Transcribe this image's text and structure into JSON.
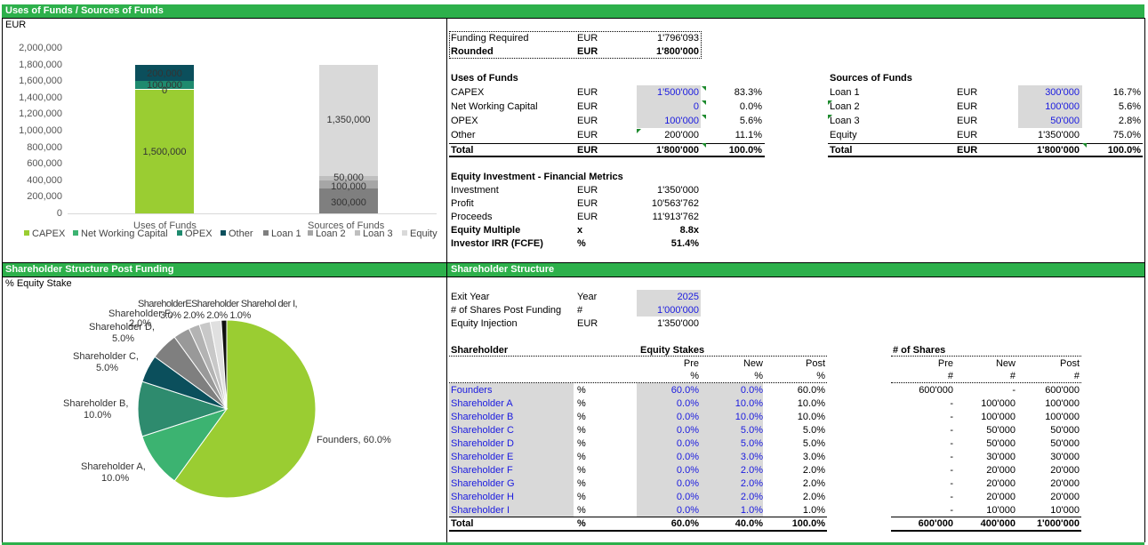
{
  "sections": {
    "uses_sources": "Uses of Funds / Sources of Funds",
    "shareholder_post": "Shareholder Structure Post Funding",
    "shareholder_structure": "Shareholder Structure"
  },
  "chart1": {
    "unit": "EUR",
    "y_ticks": [
      "2,000,000",
      "1,800,000",
      "1,600,000",
      "1,400,000",
      "1,200,000",
      "1,000,000",
      "800,000",
      "600,000",
      "400,000",
      "200,000",
      "0"
    ],
    "categories": [
      "Uses of Funds",
      "Sources of Funds"
    ],
    "labels": {
      "capex": "1,500,000",
      "opex": "100,000",
      "nwc": "0",
      "other": "200,000",
      "equity": "1,350,000",
      "loan3": "50,000",
      "loan2": "100,000",
      "loan1": "300,000"
    },
    "legend": [
      "CAPEX",
      "Net Working Capital",
      "OPEX",
      "Other",
      "Loan 1",
      "Loan 2",
      "Loan 3",
      "Equity"
    ],
    "colors": {
      "capex": "#9acd32",
      "nwc": "#3cb371",
      "opex": "#1e8a6e",
      "other": "#0b4f5c",
      "loan1": "#7f7f7f",
      "loan2": "#a6a6a6",
      "loan3": "#bfbfbf",
      "equity": "#d9d9d9"
    }
  },
  "chart_data": [
    {
      "type": "bar",
      "title": "",
      "ylabel": "EUR",
      "ylim": [
        0,
        2000000
      ],
      "categories": [
        "Uses of Funds",
        "Sources of Funds"
      ],
      "series": [
        {
          "name": "CAPEX",
          "values": [
            1500000,
            0
          ]
        },
        {
          "name": "Net Working Capital",
          "values": [
            0,
            0
          ]
        },
        {
          "name": "OPEX",
          "values": [
            100000,
            0
          ]
        },
        {
          "name": "Other",
          "values": [
            200000,
            0
          ]
        },
        {
          "name": "Loan 1",
          "values": [
            0,
            300000
          ]
        },
        {
          "name": "Loan 2",
          "values": [
            0,
            100000
          ]
        },
        {
          "name": "Loan 3",
          "values": [
            0,
            50000
          ]
        },
        {
          "name": "Equity",
          "values": [
            0,
            1350000
          ]
        }
      ]
    },
    {
      "type": "pie",
      "title": "% Equity Stake",
      "categories": [
        "Founders",
        "Shareholder A",
        "Shareholder B",
        "Shareholder C",
        "Shareholder D",
        "Shareholder E",
        "Shareholder F",
        "Shareholder G",
        "Shareholder H",
        "Shareholder I"
      ],
      "values": [
        60.0,
        10.0,
        10.0,
        5.0,
        5.0,
        3.0,
        2.0,
        2.0,
        2.0,
        1.0
      ]
    }
  ],
  "pie": {
    "title": "% Equity Stake",
    "labels": {
      "founders": "Founders, 60.0%",
      "a1": "Shareholder A,",
      "a2": "10.0%",
      "b1": "Shareholder B,",
      "b2": "10.0%",
      "c1": "Shareholder C,",
      "c2": "5.0%",
      "d1": "Shareholder D,",
      "d2": "5.0%",
      "e_cluster": "ShareholderEShareholder Sharehol der I,",
      "e_vals": "3.0%  2.0%  2.0%  1.0%",
      "e_cluster2": "Shareholder F,",
      "e_cluster3": "2.0%"
    },
    "colors": [
      "#9acd32",
      "#3cb371",
      "#2e8b6e",
      "#0b4f5c",
      "#7f7f7f",
      "#999999",
      "#b3b3b3",
      "#c8c8c8",
      "#e0e0e0",
      "#111111"
    ]
  },
  "funding": {
    "required_label": "Funding Required",
    "required_cur": "EUR",
    "required_val": "1'796'093",
    "rounded_label": "Rounded",
    "rounded_cur": "EUR",
    "rounded_val": "1'800'000"
  },
  "uses": {
    "title": "Uses of Funds",
    "rows": [
      {
        "label": "CAPEX",
        "cur": "EUR",
        "val": "1'500'000",
        "pct": "83.3%"
      },
      {
        "label": "Net Working Capital",
        "cur": "EUR",
        "val": "0",
        "pct": "0.0%"
      },
      {
        "label": "OPEX",
        "cur": "EUR",
        "val": "100'000",
        "pct": "5.6%"
      },
      {
        "label": "Other",
        "cur": "EUR",
        "val": "200'000",
        "pct": "11.1%"
      }
    ],
    "total": {
      "label": "Total",
      "cur": "EUR",
      "val": "1'800'000",
      "pct": "100.0%"
    }
  },
  "sources": {
    "title": "Sources of Funds",
    "rows": [
      {
        "label": "Loan 1",
        "cur": "EUR",
        "val": "300'000",
        "pct": "16.7%"
      },
      {
        "label": "Loan 2",
        "cur": "EUR",
        "val": "100'000",
        "pct": "5.6%"
      },
      {
        "label": "Loan 3",
        "cur": "EUR",
        "val": "50'000",
        "pct": "2.8%"
      },
      {
        "label": "Equity",
        "cur": "EUR",
        "val": "1'350'000",
        "pct": "75.0%"
      }
    ],
    "total": {
      "label": "Total",
      "cur": "EUR",
      "val": "1'800'000",
      "pct": "100.0%"
    }
  },
  "metrics": {
    "title": "Equity Investment - Financial Metrics",
    "rows": [
      {
        "label": "Investment",
        "cur": "EUR",
        "val": "1'350'000",
        "bold": false
      },
      {
        "label": "Profit",
        "cur": "EUR",
        "val": "10'563'762",
        "bold": false
      },
      {
        "label": "Proceeds",
        "cur": "EUR",
        "val": "11'913'762",
        "bold": false
      },
      {
        "label": "Equity Multiple",
        "cur": "x",
        "val": "8.8x",
        "bold": true
      },
      {
        "label": "Investor IRR (FCFE)",
        "cur": "%",
        "val": "51.4%",
        "bold": true
      }
    ]
  },
  "structure": {
    "exit_label": "Exit Year",
    "exit_unit": "Year",
    "exit_val": "2025",
    "shares_label": "# of Shares Post Funding",
    "shares_unit": "#",
    "shares_val": "1'000'000",
    "inj_label": "Equity Injection",
    "inj_unit": "EUR",
    "inj_val": "1'350'000",
    "col_shareholder": "Shareholder",
    "col_stakes": "Equity Stakes",
    "col_shares": "# of Shares",
    "pre": "Pre",
    "new": "New",
    "post": "Post",
    "pct": "%",
    "hash": "#",
    "rows": [
      {
        "name": "Founders",
        "u": "%",
        "pre": "60.0%",
        "new": "0.0%",
        "post": "60.0%",
        "spre": "600'000",
        "snew": "-",
        "spost": "600'000"
      },
      {
        "name": "Shareholder A",
        "u": "%",
        "pre": "0.0%",
        "new": "10.0%",
        "post": "10.0%",
        "spre": "-",
        "snew": "100'000",
        "spost": "100'000"
      },
      {
        "name": "Shareholder B",
        "u": "%",
        "pre": "0.0%",
        "new": "10.0%",
        "post": "10.0%",
        "spre": "-",
        "snew": "100'000",
        "spost": "100'000"
      },
      {
        "name": "Shareholder C",
        "u": "%",
        "pre": "0.0%",
        "new": "5.0%",
        "post": "5.0%",
        "spre": "-",
        "snew": "50'000",
        "spost": "50'000"
      },
      {
        "name": "Shareholder D",
        "u": "%",
        "pre": "0.0%",
        "new": "5.0%",
        "post": "5.0%",
        "spre": "-",
        "snew": "50'000",
        "spost": "50'000"
      },
      {
        "name": "Shareholder E",
        "u": "%",
        "pre": "0.0%",
        "new": "3.0%",
        "post": "3.0%",
        "spre": "-",
        "snew": "30'000",
        "spost": "30'000"
      },
      {
        "name": "Shareholder F",
        "u": "%",
        "pre": "0.0%",
        "new": "2.0%",
        "post": "2.0%",
        "spre": "-",
        "snew": "20'000",
        "spost": "20'000"
      },
      {
        "name": "Shareholder G",
        "u": "%",
        "pre": "0.0%",
        "new": "2.0%",
        "post": "2.0%",
        "spre": "-",
        "snew": "20'000",
        "spost": "20'000"
      },
      {
        "name": "Shareholder H",
        "u": "%",
        "pre": "0.0%",
        "new": "2.0%",
        "post": "2.0%",
        "spre": "-",
        "snew": "20'000",
        "spost": "20'000"
      },
      {
        "name": "Shareholder I",
        "u": "%",
        "pre": "0.0%",
        "new": "1.0%",
        "post": "1.0%",
        "spre": "-",
        "snew": "10'000",
        "spost": "10'000"
      }
    ],
    "total": {
      "name": "Total",
      "u": "%",
      "pre": "60.0%",
      "new": "40.0%",
      "post": "100.0%",
      "spre": "600'000",
      "snew": "400'000",
      "spost": "1'000'000"
    }
  }
}
